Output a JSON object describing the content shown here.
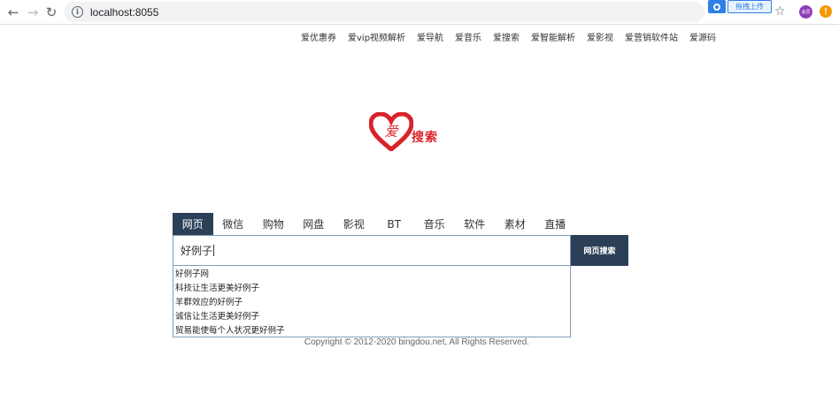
{
  "browser": {
    "url": "localhost:8055",
    "extension_label": "拖拽上传",
    "avatar_text": "会员",
    "alert_text": "!"
  },
  "top_links": [
    "爱优惠券",
    "爱vip视频解析",
    "爱导航",
    "爱音乐",
    "爱搜索",
    "爱智能解析",
    "爱影视",
    "爱营销软件站",
    "爱源码"
  ],
  "logo": {
    "heart_char": "爱",
    "text": "搜索",
    "colors": {
      "heart": "#d9232a"
    }
  },
  "tabs": [
    {
      "label": "网页",
      "active": true
    },
    {
      "label": "微信"
    },
    {
      "label": "购物"
    },
    {
      "label": "网盘"
    },
    {
      "label": "影视"
    },
    {
      "label": "BT"
    },
    {
      "label": "音乐"
    },
    {
      "label": "软件"
    },
    {
      "label": "素材"
    },
    {
      "label": "直播"
    }
  ],
  "search": {
    "value": "好例子",
    "button_label": "网页搜索"
  },
  "suggestions": [
    "好例子网",
    "科技让生活更美好例子",
    "羊群效应的好例子",
    "诚信让生活更美好例子",
    "贸易能使每个人状况更好例子"
  ],
  "copyright": "Copyright © 2012-2020 bingdou.net, All Rights Reserved.",
  "colors": {
    "accent": "#2b4056",
    "input_border": "#7f9db9"
  }
}
